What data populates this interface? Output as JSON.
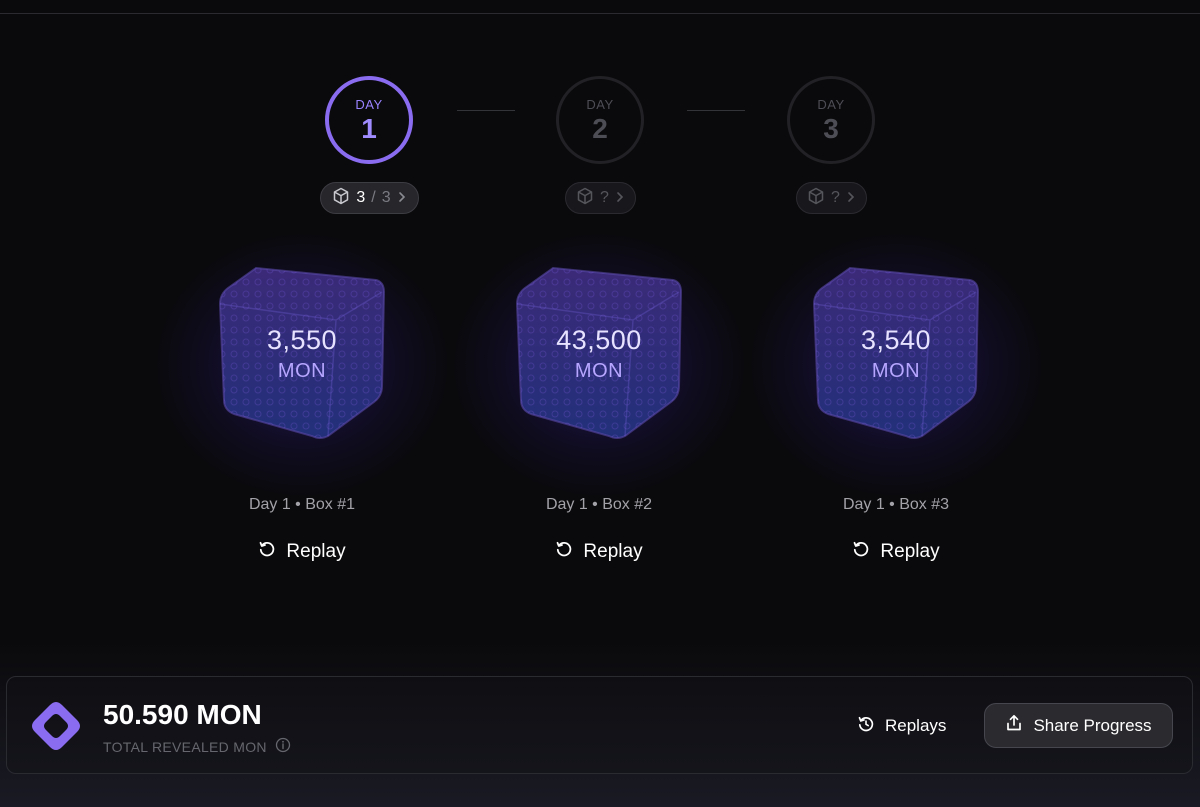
{
  "steps": [
    {
      "label": "DAY",
      "number": "1",
      "active": true
    },
    {
      "label": "DAY",
      "number": "2",
      "active": false
    },
    {
      "label": "DAY",
      "number": "3",
      "active": false
    }
  ],
  "chips": [
    {
      "opened": "3",
      "separator": "/",
      "total": "3",
      "icon": "cube-icon"
    },
    {
      "opened": "?",
      "icon": "cube-icon"
    },
    {
      "opened": "?",
      "icon": "cube-icon"
    }
  ],
  "boxes": [
    {
      "value": "3,550",
      "unit": "MON",
      "caption": "Day 1 • Box #1",
      "replay": "Replay"
    },
    {
      "value": "43,500",
      "unit": "MON",
      "caption": "Day 1 • Box #2",
      "replay": "Replay"
    },
    {
      "value": "3,540",
      "unit": "MON",
      "caption": "Day 1 • Box #3",
      "replay": "Replay"
    }
  ],
  "footer": {
    "total_amount": "50.590 MON",
    "total_label": "TOTAL REVEALED MON",
    "replays_label": "Replays",
    "share_label": "Share Progress"
  },
  "colors": {
    "accent": "#8a6cf0",
    "background": "#0a0a0c",
    "box_glow": "#4628c8"
  }
}
